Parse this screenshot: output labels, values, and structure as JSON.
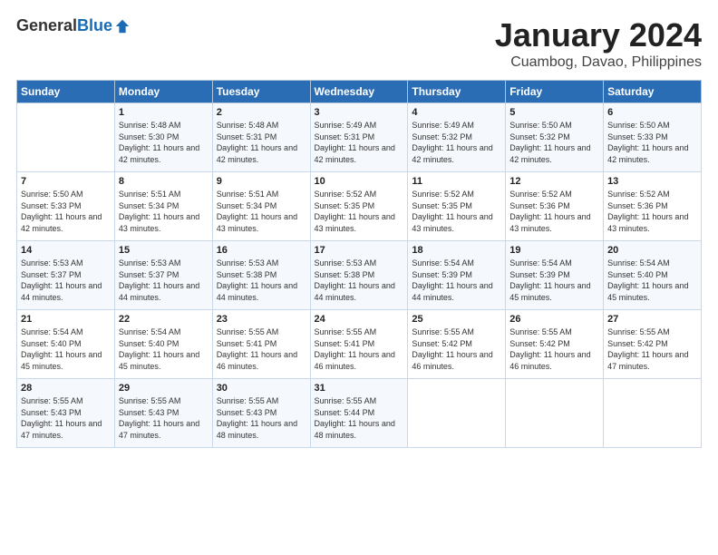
{
  "logo": {
    "general": "General",
    "blue": "Blue"
  },
  "header": {
    "month": "January 2024",
    "location": "Cuambog, Davao, Philippines"
  },
  "weekdays": [
    "Sunday",
    "Monday",
    "Tuesday",
    "Wednesday",
    "Thursday",
    "Friday",
    "Saturday"
  ],
  "weeks": [
    [
      {
        "day": "",
        "sunrise": "",
        "sunset": "",
        "daylight": ""
      },
      {
        "day": "1",
        "sunrise": "Sunrise: 5:48 AM",
        "sunset": "Sunset: 5:30 PM",
        "daylight": "Daylight: 11 hours and 42 minutes."
      },
      {
        "day": "2",
        "sunrise": "Sunrise: 5:48 AM",
        "sunset": "Sunset: 5:31 PM",
        "daylight": "Daylight: 11 hours and 42 minutes."
      },
      {
        "day": "3",
        "sunrise": "Sunrise: 5:49 AM",
        "sunset": "Sunset: 5:31 PM",
        "daylight": "Daylight: 11 hours and 42 minutes."
      },
      {
        "day": "4",
        "sunrise": "Sunrise: 5:49 AM",
        "sunset": "Sunset: 5:32 PM",
        "daylight": "Daylight: 11 hours and 42 minutes."
      },
      {
        "day": "5",
        "sunrise": "Sunrise: 5:50 AM",
        "sunset": "Sunset: 5:32 PM",
        "daylight": "Daylight: 11 hours and 42 minutes."
      },
      {
        "day": "6",
        "sunrise": "Sunrise: 5:50 AM",
        "sunset": "Sunset: 5:33 PM",
        "daylight": "Daylight: 11 hours and 42 minutes."
      }
    ],
    [
      {
        "day": "7",
        "sunrise": "Sunrise: 5:50 AM",
        "sunset": "Sunset: 5:33 PM",
        "daylight": "Daylight: 11 hours and 42 minutes."
      },
      {
        "day": "8",
        "sunrise": "Sunrise: 5:51 AM",
        "sunset": "Sunset: 5:34 PM",
        "daylight": "Daylight: 11 hours and 43 minutes."
      },
      {
        "day": "9",
        "sunrise": "Sunrise: 5:51 AM",
        "sunset": "Sunset: 5:34 PM",
        "daylight": "Daylight: 11 hours and 43 minutes."
      },
      {
        "day": "10",
        "sunrise": "Sunrise: 5:52 AM",
        "sunset": "Sunset: 5:35 PM",
        "daylight": "Daylight: 11 hours and 43 minutes."
      },
      {
        "day": "11",
        "sunrise": "Sunrise: 5:52 AM",
        "sunset": "Sunset: 5:35 PM",
        "daylight": "Daylight: 11 hours and 43 minutes."
      },
      {
        "day": "12",
        "sunrise": "Sunrise: 5:52 AM",
        "sunset": "Sunset: 5:36 PM",
        "daylight": "Daylight: 11 hours and 43 minutes."
      },
      {
        "day": "13",
        "sunrise": "Sunrise: 5:52 AM",
        "sunset": "Sunset: 5:36 PM",
        "daylight": "Daylight: 11 hours and 43 minutes."
      }
    ],
    [
      {
        "day": "14",
        "sunrise": "Sunrise: 5:53 AM",
        "sunset": "Sunset: 5:37 PM",
        "daylight": "Daylight: 11 hours and 44 minutes."
      },
      {
        "day": "15",
        "sunrise": "Sunrise: 5:53 AM",
        "sunset": "Sunset: 5:37 PM",
        "daylight": "Daylight: 11 hours and 44 minutes."
      },
      {
        "day": "16",
        "sunrise": "Sunrise: 5:53 AM",
        "sunset": "Sunset: 5:38 PM",
        "daylight": "Daylight: 11 hours and 44 minutes."
      },
      {
        "day": "17",
        "sunrise": "Sunrise: 5:53 AM",
        "sunset": "Sunset: 5:38 PM",
        "daylight": "Daylight: 11 hours and 44 minutes."
      },
      {
        "day": "18",
        "sunrise": "Sunrise: 5:54 AM",
        "sunset": "Sunset: 5:39 PM",
        "daylight": "Daylight: 11 hours and 44 minutes."
      },
      {
        "day": "19",
        "sunrise": "Sunrise: 5:54 AM",
        "sunset": "Sunset: 5:39 PM",
        "daylight": "Daylight: 11 hours and 45 minutes."
      },
      {
        "day": "20",
        "sunrise": "Sunrise: 5:54 AM",
        "sunset": "Sunset: 5:40 PM",
        "daylight": "Daylight: 11 hours and 45 minutes."
      }
    ],
    [
      {
        "day": "21",
        "sunrise": "Sunrise: 5:54 AM",
        "sunset": "Sunset: 5:40 PM",
        "daylight": "Daylight: 11 hours and 45 minutes."
      },
      {
        "day": "22",
        "sunrise": "Sunrise: 5:54 AM",
        "sunset": "Sunset: 5:40 PM",
        "daylight": "Daylight: 11 hours and 45 minutes."
      },
      {
        "day": "23",
        "sunrise": "Sunrise: 5:55 AM",
        "sunset": "Sunset: 5:41 PM",
        "daylight": "Daylight: 11 hours and 46 minutes."
      },
      {
        "day": "24",
        "sunrise": "Sunrise: 5:55 AM",
        "sunset": "Sunset: 5:41 PM",
        "daylight": "Daylight: 11 hours and 46 minutes."
      },
      {
        "day": "25",
        "sunrise": "Sunrise: 5:55 AM",
        "sunset": "Sunset: 5:42 PM",
        "daylight": "Daylight: 11 hours and 46 minutes."
      },
      {
        "day": "26",
        "sunrise": "Sunrise: 5:55 AM",
        "sunset": "Sunset: 5:42 PM",
        "daylight": "Daylight: 11 hours and 46 minutes."
      },
      {
        "day": "27",
        "sunrise": "Sunrise: 5:55 AM",
        "sunset": "Sunset: 5:42 PM",
        "daylight": "Daylight: 11 hours and 47 minutes."
      }
    ],
    [
      {
        "day": "28",
        "sunrise": "Sunrise: 5:55 AM",
        "sunset": "Sunset: 5:43 PM",
        "daylight": "Daylight: 11 hours and 47 minutes."
      },
      {
        "day": "29",
        "sunrise": "Sunrise: 5:55 AM",
        "sunset": "Sunset: 5:43 PM",
        "daylight": "Daylight: 11 hours and 47 minutes."
      },
      {
        "day": "30",
        "sunrise": "Sunrise: 5:55 AM",
        "sunset": "Sunset: 5:43 PM",
        "daylight": "Daylight: 11 hours and 48 minutes."
      },
      {
        "day": "31",
        "sunrise": "Sunrise: 5:55 AM",
        "sunset": "Sunset: 5:44 PM",
        "daylight": "Daylight: 11 hours and 48 minutes."
      },
      {
        "day": "",
        "sunrise": "",
        "sunset": "",
        "daylight": ""
      },
      {
        "day": "",
        "sunrise": "",
        "sunset": "",
        "daylight": ""
      },
      {
        "day": "",
        "sunrise": "",
        "sunset": "",
        "daylight": ""
      }
    ]
  ]
}
